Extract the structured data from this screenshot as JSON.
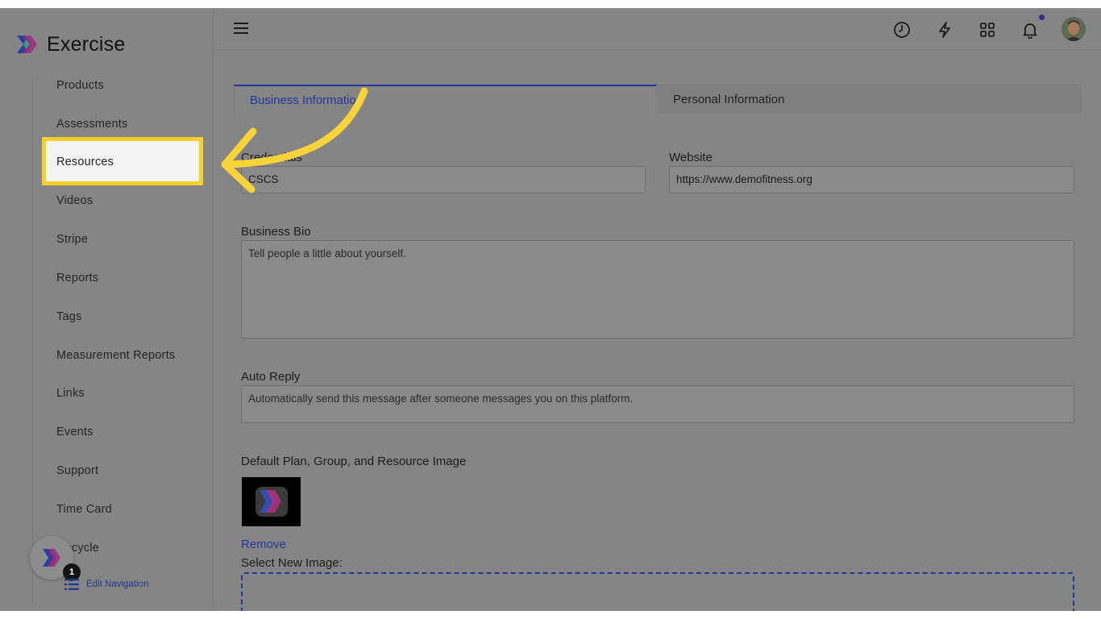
{
  "app": {
    "brand_name": "Exercise"
  },
  "sidebar": {
    "items": [
      {
        "label": "Products"
      },
      {
        "label": "Assessments"
      },
      {
        "label": "Resources"
      },
      {
        "label": "Videos"
      },
      {
        "label": "Stripe"
      },
      {
        "label": "Reports"
      },
      {
        "label": "Tags"
      },
      {
        "label": "Measurement Reports"
      },
      {
        "label": "Links"
      },
      {
        "label": "Events"
      },
      {
        "label": "Support"
      },
      {
        "label": "Time Card"
      },
      {
        "label": "Recycle"
      }
    ],
    "highlighted_item": "Resources",
    "edit_navigation_label": "Edit Navigation",
    "badge_count": "1"
  },
  "topbar": {
    "icons": [
      "menu-icon",
      "clock-icon",
      "lightning-icon",
      "grid-icon",
      "bell-icon",
      "user-avatar"
    ]
  },
  "tabs": [
    {
      "label": "Business Information",
      "active": true
    },
    {
      "label": "Personal Information",
      "active": false
    }
  ],
  "form": {
    "credentials": {
      "label": "Credentials",
      "value": "CSCS"
    },
    "website": {
      "label": "Website",
      "value": "https://www.demofitness.org"
    },
    "business_bio": {
      "label": "Business Bio",
      "placeholder": "Tell people a little about yourself."
    },
    "auto_reply": {
      "label": "Auto Reply",
      "placeholder": "Automatically send this message after someone messages you on this platform."
    },
    "default_image": {
      "label": "Default Plan, Group, and Resource Image",
      "remove_label": "Remove",
      "select_label": "Select New Image:"
    }
  },
  "colors": {
    "overlay": "#858585",
    "highlight": "#f6cf2d",
    "arrow": "#f8d33a",
    "link": "#23379a"
  }
}
